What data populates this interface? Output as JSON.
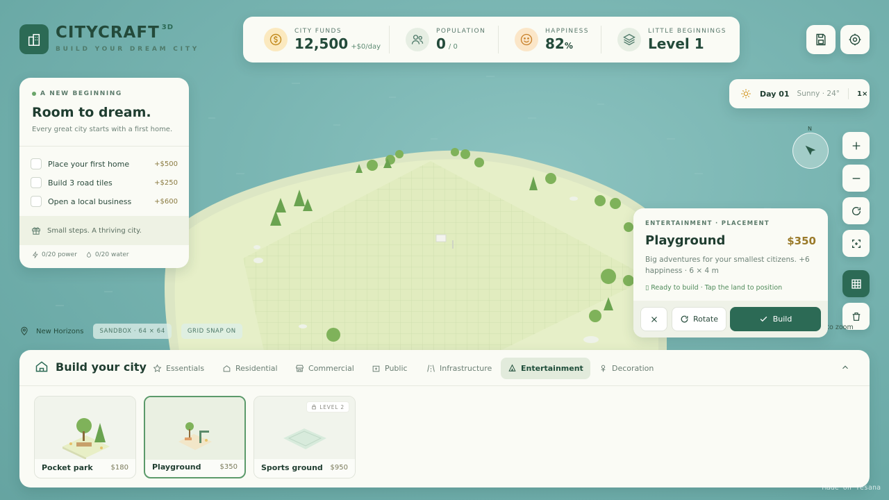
{
  "app": {
    "name": "CITYCRAFT",
    "badge": "3D",
    "tagline": "BUILD YOUR DREAM CITY"
  },
  "stats": {
    "funds": {
      "label": "CITY FUNDS",
      "value": "12,500",
      "sub": "+$0/day"
    },
    "population": {
      "label": "POPULATION",
      "value": "0",
      "sub": "/ 0"
    },
    "happiness": {
      "label": "HAPPINESS",
      "value": "82",
      "unit": "%"
    },
    "level": {
      "label": "LITTLE BEGINNINGS",
      "value": "Level 1"
    }
  },
  "quest": {
    "tag": "A NEW BEGINNING",
    "title": "Room to dream.",
    "desc": "Every great city starts with a first home.",
    "tasks": [
      {
        "label": "Place your first home",
        "reward": "+$500"
      },
      {
        "label": "Build 3 road tiles",
        "reward": "+$250"
      },
      {
        "label": "Open a local business",
        "reward": "+$600"
      }
    ],
    "footer": "Small steps. A thriving city.",
    "power": "0/20 power",
    "water": "0/20 water"
  },
  "weather": {
    "day": "Day 01",
    "condition": "Sunny · 24°",
    "speed": "1×"
  },
  "compass": {
    "label": "N"
  },
  "placement": {
    "category": "ENTERTAINMENT · PLACEMENT",
    "name": "Playground",
    "price": "$350",
    "desc": "Big adventures for your smallest citizens. +6 happiness · 6 × 4 m",
    "ready": "▯ Ready to build · Tap the land to position",
    "rotate": "Rotate",
    "build": "Build"
  },
  "hint": "ll to zoom",
  "location": {
    "name": "New Horizons",
    "mode": "SANDBOX · 64 × 64",
    "snap": "GRID SNAP ON"
  },
  "build": {
    "title": "Build your city",
    "tabs": [
      "Essentials",
      "Residential",
      "Commercial",
      "Public",
      "Infrastructure",
      "Entertainment",
      "Decoration"
    ],
    "items": [
      {
        "name": "Pocket park",
        "price": "$180"
      },
      {
        "name": "Playground",
        "price": "$350"
      },
      {
        "name": "Sports ground",
        "price": "$950",
        "lock": "LEVEL 2"
      }
    ]
  },
  "watermark": "Made on Tesana",
  "colors": {
    "accent": "#2c6a55",
    "water": "#79b5b2",
    "land": "#e3eec4"
  }
}
